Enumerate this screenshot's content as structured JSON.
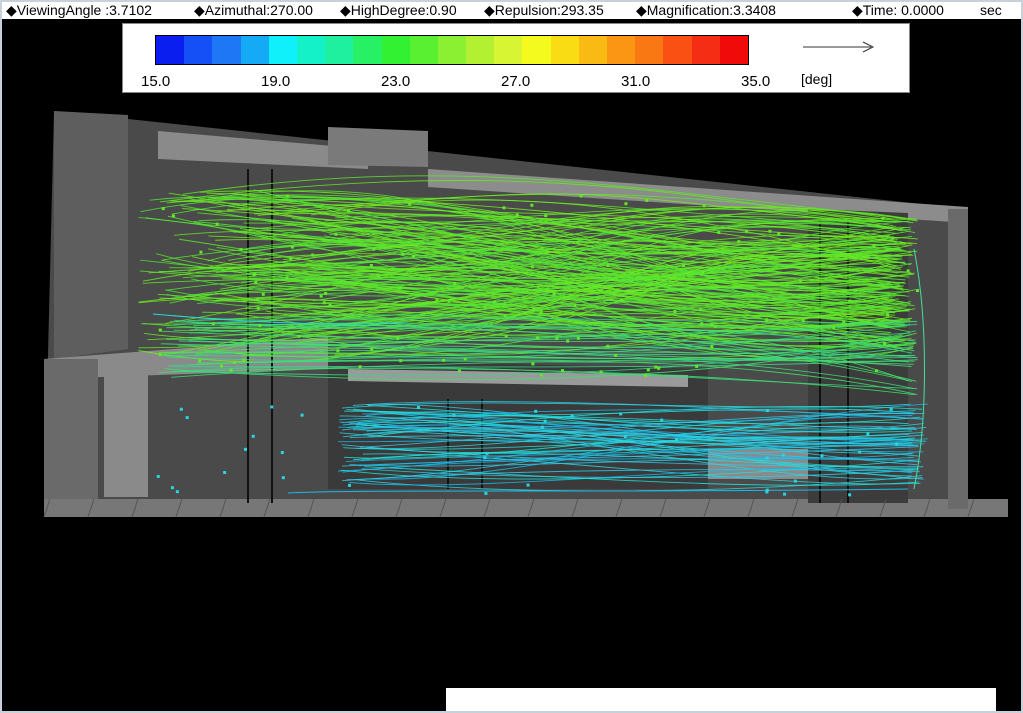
{
  "status_bar": {
    "viewing_angle": "◆ViewingAngle :3.7102",
    "azimuthal": "◆Azimuthal:270.00",
    "high_degree": "◆HighDegree:0.90",
    "repulsion": "◆Repulsion:293.35",
    "magnification": "◆Magnification:3.3408",
    "time": "◆Time: 0.0000",
    "time_unit": "sec"
  },
  "legend": {
    "ticks": [
      "15.0",
      "19.0",
      "23.0",
      "27.0",
      "31.0",
      "35.0"
    ],
    "unit": "[deg]",
    "colors": [
      "#0a1ef0",
      "#1450f5",
      "#1e78f5",
      "#14aaf5",
      "#0ff0fa",
      "#14f0c8",
      "#1ef0a0",
      "#28f064",
      "#32f032",
      "#5af032",
      "#8cf032",
      "#b4f032",
      "#d7f532",
      "#f5fa1e",
      "#fadc14",
      "#faba14",
      "#fa9614",
      "#fa7814",
      "#fa5014",
      "#f52d14",
      "#f00a0a"
    ],
    "arrow_icon": "flow-direction-arrow"
  },
  "scene": {
    "description_icon": "airflow-streamline-visualization",
    "stream_colors": {
      "warm": "#5ee82a",
      "mid": "#3fe06a",
      "cool": "#2ad4e0",
      "dark_cool": "#1ab8e8"
    }
  }
}
